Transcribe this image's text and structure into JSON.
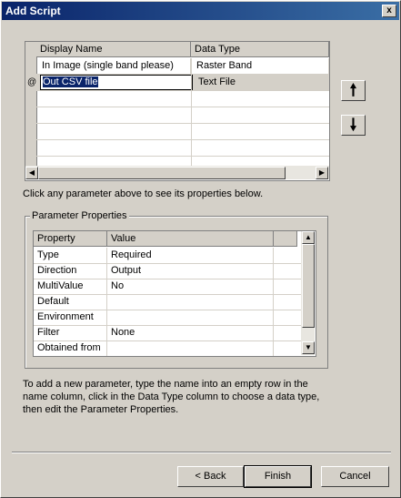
{
  "window": {
    "title": "Add Script",
    "close_glyph": "x"
  },
  "params_grid": {
    "headers": [
      "Display Name",
      "Data Type"
    ],
    "rows": [
      {
        "name": "In Image (single band please)",
        "type": "Raster Band"
      },
      {
        "name": "Out CSV file",
        "type": "Text File",
        "editing": true,
        "marker": "@"
      }
    ]
  },
  "move_up_glyph": "🠕",
  "move_down_glyph": "🠗",
  "hint_top": "Click any parameter above to see its properties below.",
  "properties": {
    "group_title": "Parameter Properties",
    "headers": [
      "Property",
      "Value"
    ],
    "rows": [
      {
        "property": "Type",
        "value": "Required"
      },
      {
        "property": "Direction",
        "value": "Output"
      },
      {
        "property": "MultiValue",
        "value": "No"
      },
      {
        "property": "Default",
        "value": ""
      },
      {
        "property": "Environment",
        "value": ""
      },
      {
        "property": "Filter",
        "value": "None"
      },
      {
        "property": "Obtained from",
        "value": ""
      }
    ]
  },
  "hint_bottom": {
    "line1": "To add a new parameter, type the name into an empty row in the",
    "line2": "name column, click in the Data Type column to choose a data type,",
    "line3": "then edit the Parameter Properties."
  },
  "buttons": {
    "back": "< Back",
    "finish": "Finish",
    "cancel": "Cancel"
  }
}
